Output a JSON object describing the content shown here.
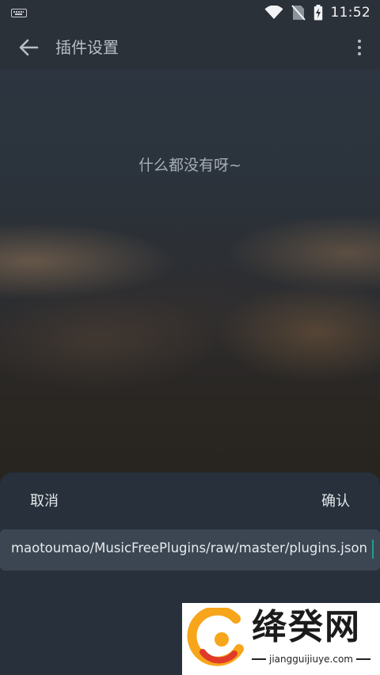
{
  "status_bar": {
    "time": "11:52",
    "icons": [
      "keyboard-icon",
      "wifi-icon",
      "no-sim-icon",
      "battery-charging-icon"
    ]
  },
  "app_bar": {
    "title": "插件设置",
    "back_icon": "arrow-left-icon",
    "more_icon": "more-vertical-icon"
  },
  "main": {
    "empty_message": "什么都没有呀~"
  },
  "sheet": {
    "cancel_label": "取消",
    "confirm_label": "确认",
    "url_value": "maotoumao/MusicFreePlugins/raw/master/plugins.json"
  },
  "watermark": {
    "brand_text": "绛癸网",
    "domain": "jiangguijiuye.com",
    "colors": {
      "logo_orange": "#f7a51a",
      "logo_red": "#e03a2a"
    }
  },
  "colors": {
    "app_bar_bg": "#2b3139",
    "sheet_bg": "#27303b",
    "input_bg": "#3b4652",
    "cursor": "#21a18a"
  }
}
